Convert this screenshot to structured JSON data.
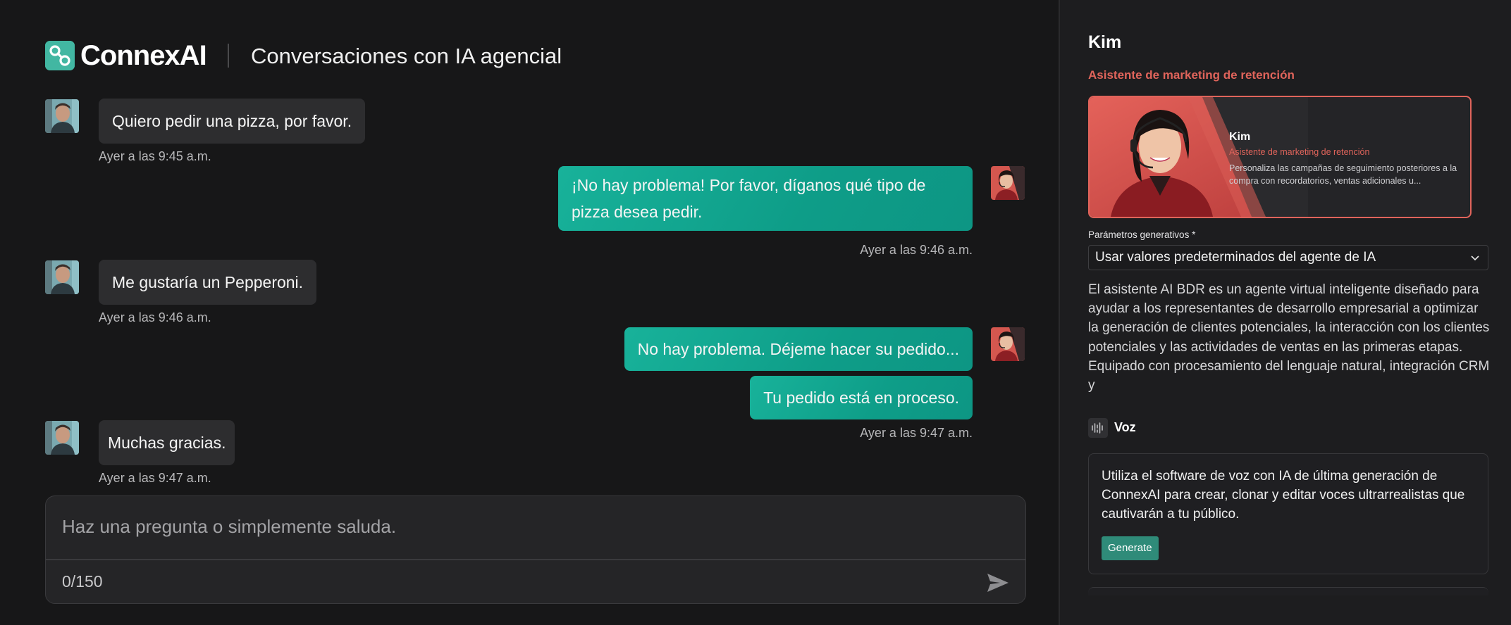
{
  "header": {
    "brand": "ConnexAI",
    "title": "Conversaciones con IA agencial"
  },
  "messages": [
    {
      "sender": "user",
      "text": "Quiero pedir una pizza, por favor.",
      "time": "Ayer a las 9:45 a.m."
    },
    {
      "sender": "agent",
      "text": "¡No hay problema! Por favor, díganos qué tipo de pizza desea pedir.",
      "time": "Ayer a las 9:46 a.m."
    },
    {
      "sender": "user",
      "text": "Me gustaría un Pepperoni.",
      "time": "Ayer a las 9:46 a.m."
    },
    {
      "sender": "agent",
      "text": "No hay problema. Déjeme hacer su pedido...",
      "time": ""
    },
    {
      "sender": "agent",
      "text": "Tu pedido está en proceso.",
      "time": "Ayer a las 9:47 a.m."
    },
    {
      "sender": "user",
      "text": "Muchas gracias.",
      "time": "Ayer a las 9:47 a.m."
    }
  ],
  "composer": {
    "placeholder": "Haz una pregunta o simplemente saluda.",
    "counter": "0/150"
  },
  "agent": {
    "name": "Kim",
    "role": "Asistente de marketing de retención",
    "card": {
      "name": "Kim",
      "role": "Asistente de marketing de retención",
      "description": "Personaliza las campañas de seguimiento posteriores a la compra con recordatorios, ventas adicionales u..."
    },
    "generative_label": "Parámetros generativos *",
    "generative_value": "Usar valores predeterminados del agente de IA",
    "description": "El asistente AI BDR es un agente virtual inteligente diseñado para ayudar a los representantes de desarrollo empresarial a optimizar la generación de clientes potenciales, la interacción con los clientes potenciales y las actividades de ventas en las primeras etapas. Equipado con procesamiento del lenguaje natural, integración CRM y",
    "voice_label": "Voz",
    "voice_text": "Utiliza el software de voz con IA de última generación de ConnexAI para crear, clonar y editar voces ultrarrealistas que cautivarán a tu público.",
    "generate_label": "Generate"
  },
  "colors": {
    "accent": "#13a994",
    "brand_logo": "#42b7a2",
    "role": "#e0645b"
  }
}
